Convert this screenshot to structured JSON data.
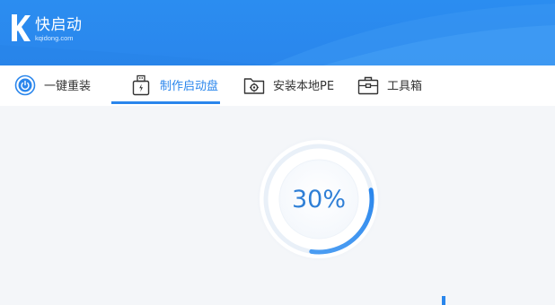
{
  "app": {
    "logo_name": "快启动",
    "logo_domain": "kqidong.com"
  },
  "tabs": [
    {
      "label": "一键重装",
      "icon": "power-icon",
      "active": false
    },
    {
      "label": "制作启动盘",
      "icon": "usb-drive-icon",
      "active": true
    },
    {
      "label": "安装本地PE",
      "icon": "folder-gear-icon",
      "active": false
    },
    {
      "label": "工具箱",
      "icon": "toolbox-icon",
      "active": false
    }
  ],
  "progress": {
    "value": 0.3,
    "label": "30%"
  },
  "colors": {
    "accent": "#2a86ec",
    "header_bg": "#2b8df0",
    "progress_text": "#2f7fd6",
    "page_bg": "#f4f6f9"
  }
}
